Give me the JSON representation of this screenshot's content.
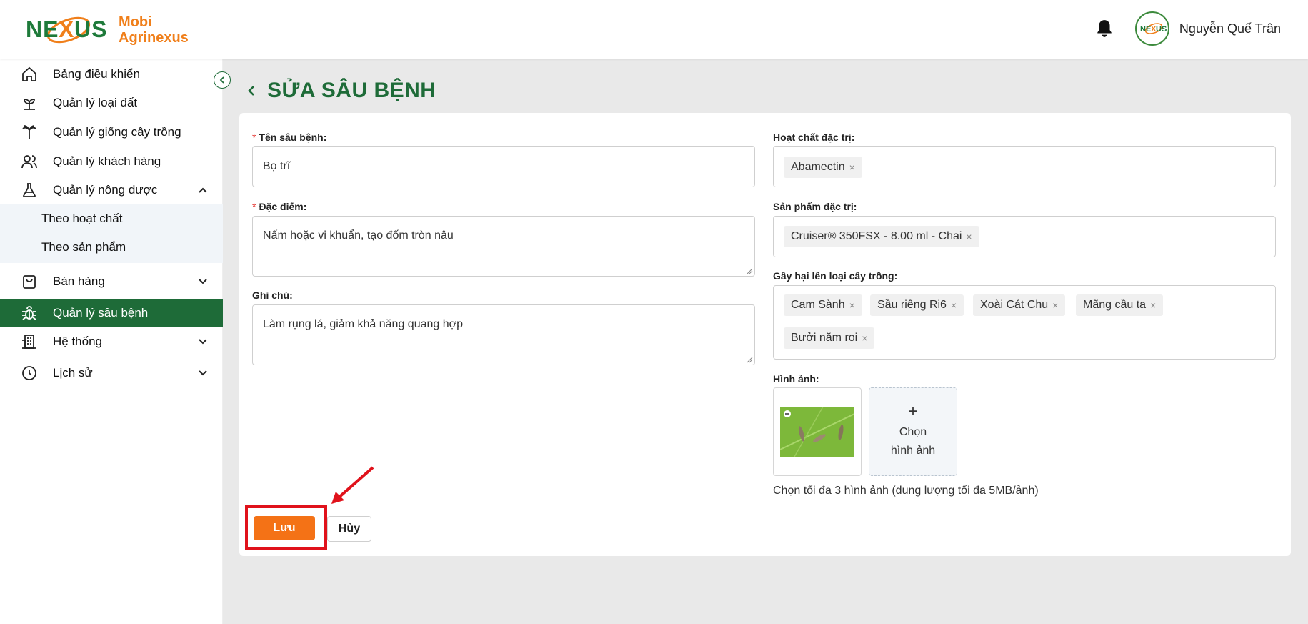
{
  "brand": {
    "logo_mark": "NEXUS",
    "name_line1": "Mobi",
    "name_line2": "Agrinexus",
    "orange": "#f07f1a",
    "green": "#1e6b38"
  },
  "header": {
    "user_name": "Nguyễn Quế Trân",
    "notification_icon": "bell-icon",
    "avatar_text": "NEXUS"
  },
  "sidebar": {
    "items": [
      {
        "label": "Bảng điều khiển",
        "icon": "home-icon"
      },
      {
        "label": "Quản lý loại đất",
        "icon": "sprout-icon"
      },
      {
        "label": "Quản lý giống cây trồng",
        "icon": "palm-tree-icon"
      },
      {
        "label": "Quản lý khách hàng",
        "icon": "users-icon"
      },
      {
        "label": "Quản lý nông dược",
        "icon": "flask-icon",
        "expanded": true
      },
      {
        "label": "Bán hàng",
        "icon": "shopping-bag-icon"
      },
      {
        "label": "Quản lý sâu bệnh",
        "icon": "bug-icon",
        "active": true
      },
      {
        "label": "Hệ thống",
        "icon": "building-icon"
      },
      {
        "label": "Lịch sử",
        "icon": "clock-icon"
      }
    ],
    "subitems": [
      {
        "label": "Theo hoạt chất"
      },
      {
        "label": "Theo sản phẩm"
      }
    ]
  },
  "page": {
    "title": "SỬA SÂU BỆNH"
  },
  "form": {
    "name": {
      "label": "Tên sâu bệnh:",
      "value": "Bọ trĩ",
      "required": true
    },
    "feature": {
      "label": "Đặc điểm:",
      "value": "Nấm hoặc vi khuẩn, tạo đốm tròn nâu",
      "required": true
    },
    "note": {
      "label": "Ghi chú:",
      "value": "Làm rụng lá, giảm khả năng quang hợp"
    },
    "active_ingredient": {
      "label": "Hoạt chất đặc trị:",
      "tags": [
        "Abamectin"
      ]
    },
    "product": {
      "label": "Sản phẩm đặc trị:",
      "tags": [
        "Cruiser® 350FSX - 8.00 ml - Chai"
      ]
    },
    "crops": {
      "label": "Gây hại lên loại cây trồng:",
      "tags": [
        "Cam Sành",
        "Sầu riêng Ri6",
        "Xoài Cát Chu",
        "Mãng cầu ta",
        "Bưởi năm roi"
      ]
    },
    "images": {
      "label": "Hình ảnh:",
      "add_line1": "Chọn",
      "add_line2": "hình ảnh",
      "hint": "Chọn tối đa 3 hình ảnh (dung lượng tối đa 5MB/ảnh)"
    }
  },
  "actions": {
    "save_label": "Lưu",
    "cancel_label": "Hủy"
  },
  "required_mark": "*",
  "tag_remove_glyph": "×"
}
